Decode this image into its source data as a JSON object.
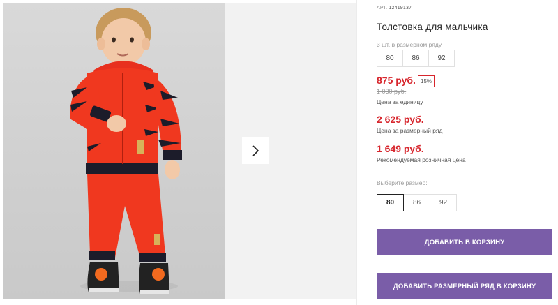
{
  "gallery": {
    "main_photo_alt": "",
    "next_icon": "chevron-right-icon"
  },
  "product": {
    "article_label": "АРТ.",
    "article_number": "12419137",
    "title": "Толстовка для мальчика",
    "pack_label": "3 шт. в размерном ряду",
    "pack_sizes": [
      "80",
      "86",
      "92"
    ],
    "price_unit": "875 руб.",
    "discount": "15%",
    "price_old": "1 030 руб.",
    "price_unit_label": "Цена за единицу",
    "price_set": "2 625 руб.",
    "price_set_label": "Цена за размерный ряд",
    "price_rrp": "1 649 руб.",
    "price_rrp_label": "Рекомендуемая розничная цена",
    "size_select_label": "Выберите размер:",
    "size_options": [
      "80",
      "86",
      "92"
    ],
    "selected_size": "80",
    "add_to_cart_label": "ДОБАВИТЬ В КОРЗИНУ",
    "add_set_to_cart_label": "ДОБАВИТЬ РАЗМЕРНЫЙ РЯД В КОРЗИНУ"
  },
  "colors": {
    "price_red": "#d7262d",
    "button_purple": "#7a5da8"
  }
}
